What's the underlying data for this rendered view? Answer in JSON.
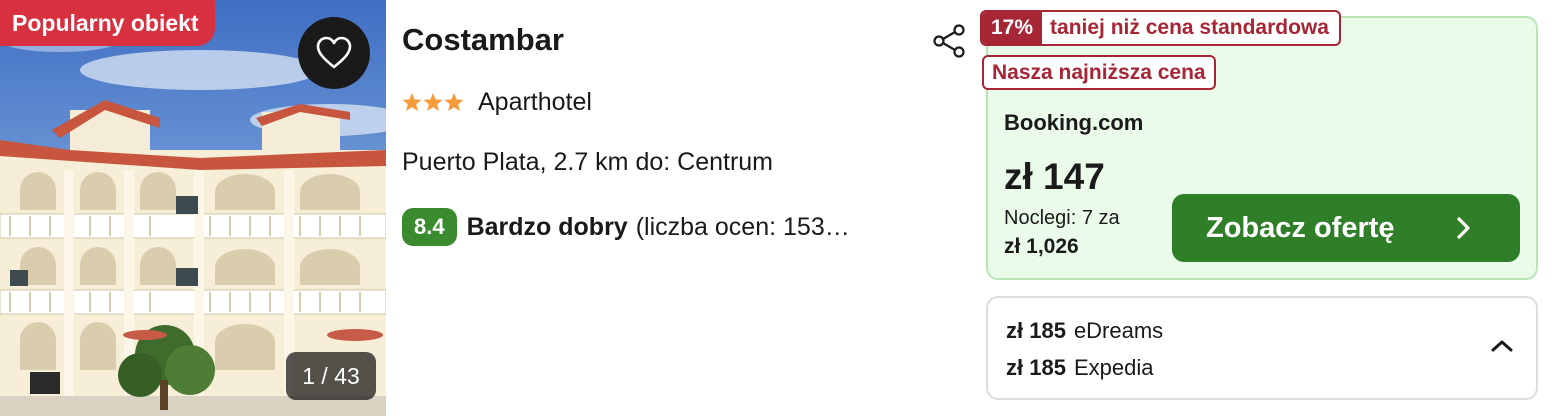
{
  "photo": {
    "badge": "Popularny obiekt",
    "counter": "1 / 43"
  },
  "hotel": {
    "name": "Costambar",
    "stars": 3,
    "category": "Aparthotel",
    "location": "Puerto Plata, 2.7 km do: Centrum",
    "rating_score": "8.4",
    "rating_word": "Bardzo dobry",
    "rating_count": "(liczba ocen: 153…"
  },
  "deal": {
    "discount_percent": "17%",
    "discount_text": "taniej niż cena standardowa",
    "lowest_price_tag": "Nasza najniższa cena",
    "provider": "Booking.com",
    "price": "zł 147",
    "nights_label": "Noclegi: 7 za",
    "total_price": "zł 1,026",
    "cta_label": "Zobacz ofertę"
  },
  "other_offers": [
    {
      "price": "zł 185",
      "provider": "eDreams"
    },
    {
      "price": "zł 185",
      "provider": "Expedia"
    }
  ],
  "colors": {
    "popular_badge": "#d7303f",
    "discount": "#a62636",
    "rating": "#3a8a2e",
    "cta": "#2f7f28",
    "deal_background": "#eafbea",
    "stars": "#f59b3c"
  },
  "icons": {
    "favorite": "heart-outline-icon",
    "share": "share-icon",
    "cta_arrow": "chevron-right-icon",
    "collapse": "chevron-up-icon"
  }
}
